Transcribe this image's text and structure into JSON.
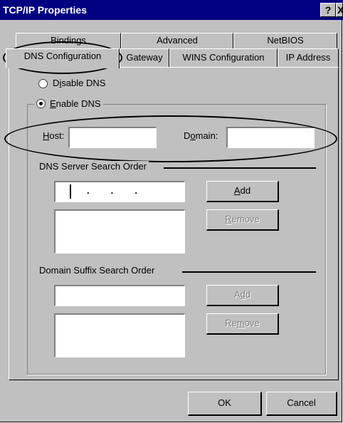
{
  "window": {
    "title": "TCP/IP Properties",
    "help_glyph": "?",
    "close_glyph": "X"
  },
  "tabs": {
    "row_top": [
      {
        "label": "Bindings"
      },
      {
        "label": "Advanced"
      },
      {
        "label": "NetBIOS"
      }
    ],
    "row_front": [
      {
        "label": "DNS Configuration",
        "selected": true
      },
      {
        "label": "Gateway"
      },
      {
        "label": "WINS Configuration"
      },
      {
        "label": "IP Address"
      }
    ]
  },
  "dns": {
    "disable_pre": "D",
    "disable_key": "i",
    "disable_post": "sable DNS",
    "enable_key": "E",
    "enable_post": "nable DNS",
    "enable_selected": true,
    "host_key": "H",
    "host_post": "ost:",
    "host_value": "",
    "domain_pre": "D",
    "domain_key": "o",
    "domain_post": "main:",
    "domain_value": "",
    "server_order_label": "DNS Server Search Order",
    "ip_value": ".     .     .",
    "add_key": "A",
    "add_post": "dd",
    "remove_key": "R",
    "remove_post": "emove",
    "suffix_order_label": "Domain Suffix Search Order",
    "suffix_value": "",
    "add2_pre": "A",
    "add2_key": "d",
    "add2_post": "d",
    "remove2_pre": "Re",
    "remove2_key": "m",
    "remove2_post": "ove"
  },
  "footer": {
    "ok": "OK",
    "cancel": "Cancel"
  },
  "colors": {
    "face": "#c0c0c0",
    "titlebar": "#000080",
    "shadow": "#808080"
  }
}
